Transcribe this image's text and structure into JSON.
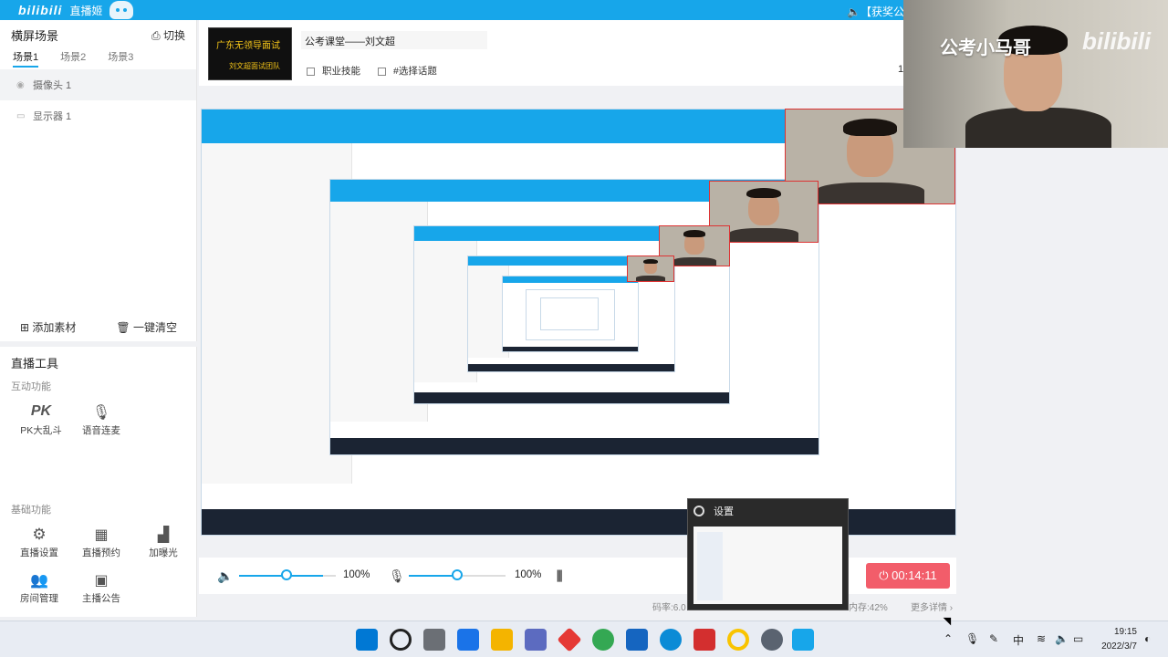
{
  "titlebar": {
    "logo": "bilibili",
    "app_name": "直播姬",
    "notice": "【获奖公"
  },
  "scene": {
    "title": "横屏场景",
    "switch_label": "切换",
    "tabs": [
      "场景1",
      "场景2",
      "场景3"
    ],
    "sources": [
      "摄像头 1",
      "显示器 1"
    ],
    "add_label": "添加素材",
    "clear_label": "一键清空"
  },
  "tools": {
    "title": "直播工具",
    "interactive_label": "互动功能",
    "interactive": [
      {
        "label": "PK大乱斗",
        "icon": "pk-icon"
      },
      {
        "label": "语音连麦",
        "icon": "mic-icon"
      }
    ],
    "basic_label": "基础功能",
    "basic": [
      {
        "label": "直播设置",
        "icon": "gear-icon"
      },
      {
        "label": "直播预约",
        "icon": "calendar-icon"
      },
      {
        "label": "加曝光",
        "icon": "chart-icon"
      },
      {
        "label": "房间管理",
        "icon": "users-icon"
      },
      {
        "label": "主播公告",
        "icon": "announce-icon"
      }
    ]
  },
  "room": {
    "cover_text1": "广东无领导面试",
    "cover_text2": "刘文超面试团队",
    "title": "公考课堂——刘文超",
    "tag1": "职业技能",
    "tag2": "#选择话题",
    "right_char": "1"
  },
  "controls": {
    "speaker_volume": "100%",
    "mic_volume": "100%",
    "live_timer": "00:14:11"
  },
  "status": {
    "bitrate": "码率:6.0",
    "memory": "内存:42%",
    "more": "更多详情"
  },
  "webcam": {
    "brand": "公考小马哥",
    "brand2": "bilibili"
  },
  "popup": {
    "title": "设置"
  },
  "taskbar": {
    "time": "19:15",
    "date": "2022/3/7",
    "ime": "中",
    "colors": {
      "start": "#0078d4",
      "explorer": "#f4b400",
      "store": "#1a73e8",
      "red": "#e53935",
      "chrome": "#34a853",
      "edge": "#0b8bd6",
      "wps": "#d32f2f",
      "yellow": "#f9c400",
      "settings": "#5a6370",
      "bili": "#17a6ea"
    }
  }
}
